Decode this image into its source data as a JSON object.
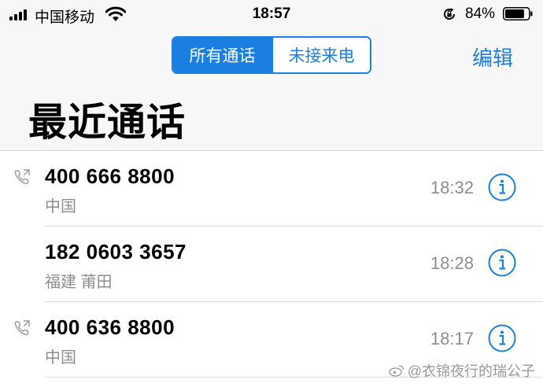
{
  "status_bar": {
    "carrier": "中国移动",
    "time": "18:57",
    "battery_percent": "84%",
    "battery_level": 0.84,
    "signal_bars": 4
  },
  "nav": {
    "segments": [
      {
        "label": "所有通话",
        "selected": true
      },
      {
        "label": "未接来电",
        "selected": false
      }
    ],
    "edit_label": "编辑"
  },
  "title": "最近通话",
  "calls": [
    {
      "number": "400 666 8800",
      "location": "中国",
      "time": "18:32",
      "has_phone_icon": true
    },
    {
      "number": "182 0603 3657",
      "location": "福建 莆田",
      "time": "18:28",
      "has_phone_icon": false
    },
    {
      "number": "400 636 8800",
      "location": "中国",
      "time": "18:17",
      "has_phone_icon": true
    }
  ],
  "watermark": "@衣锦夜行的瑞公子",
  "colors": {
    "accent": "#1a7fe0",
    "secondary_text": "#8e8e93",
    "chrome_bg": "#f7f7f7"
  }
}
